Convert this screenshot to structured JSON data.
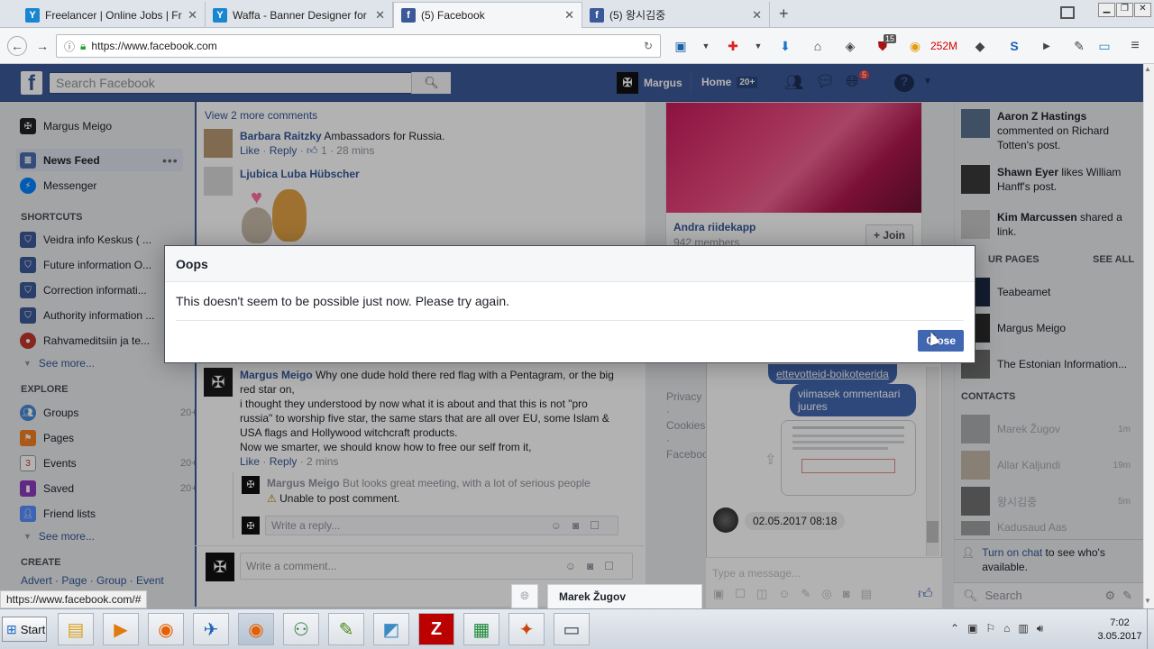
{
  "browser": {
    "tabs": [
      {
        "title": "Freelancer | Online Jobs | Free",
        "icon": "freelancer-icon",
        "color": "#1a86d0"
      },
      {
        "title": "Waffa - Banner Designer for",
        "icon": "freelancer-icon",
        "color": "#1a86d0"
      },
      {
        "title": "(5) Facebook",
        "icon": "facebook-icon",
        "color": "#3b5998"
      },
      {
        "title": "(5) 왕시김중",
        "icon": "facebook-icon",
        "color": "#3b5998"
      }
    ],
    "new_tab": "+",
    "url": "https://www.facebook.com",
    "ublock_badge": "15",
    "mega_count": "252M"
  },
  "fb": {
    "search_placeholder": "Search Facebook",
    "user_name": "Margus",
    "home_label": "Home",
    "home_badge": "20+",
    "notif_badge": "5"
  },
  "left": {
    "profile_name": "Margus Meigo",
    "news_feed": "News Feed",
    "messenger": "Messenger",
    "shortcuts_head": "SHORTCUTS",
    "shortcuts": [
      {
        "label": "Veidra info Keskus ( ..."
      },
      {
        "label": "Future information O..."
      },
      {
        "label": "Correction informati..."
      },
      {
        "label": "Authority information ..."
      },
      {
        "label": "Rahvameditsiin ja te..."
      }
    ],
    "see_more": "See more...",
    "explore_head": "EXPLORE",
    "explore": [
      {
        "label": "Groups",
        "count": "20+"
      },
      {
        "label": "Pages",
        "count": ""
      },
      {
        "label": "Events",
        "count": "20+"
      },
      {
        "label": "Saved",
        "count": "20+"
      },
      {
        "label": "Friend lists",
        "count": ""
      }
    ],
    "see_more2": "See more...",
    "create_head": "CREATE",
    "create_links": "Advert · Page · Group · Event"
  },
  "feed": {
    "view_more": "View 2 more comments",
    "c1_name": "Barbara Raitzky",
    "c1_text": "Ambassadors for Russia.",
    "like": "Like",
    "reply": "Reply",
    "c1_likes": "1",
    "c1_time": "28 mins",
    "c2_name": "Ljubica Luba Hübscher",
    "c3_name": "Margus Meigo",
    "c3_text1": "Why one dude hold there red flag with a Pentagram, or the big red star on,",
    "c3_text2": "i thought they understood by now what it is about and that this is not \"pro russia\" to worship five star, the same stars that are all over EU, some Islam & USA flags and Hollywood witchcraft products.",
    "c3_text3": "Now we smarter, we should know how to free our self from it,",
    "c3_time": "2 mins",
    "r1_name": "Margus Meigo",
    "r1_text": "But looks great meeting, with a lot of serious people",
    "r1_error": "Unable to post comment.",
    "reply_placeholder": "Write a reply...",
    "comment_placeholder": "Write a comment..."
  },
  "mid": {
    "group_name": "Andra riidekapp",
    "group_members": "942 members",
    "join": "+ Join",
    "footer": "Privacy · Cookies · Facebook"
  },
  "right": {
    "ticker": [
      {
        "name": "Aaron Z Hastings",
        "text": " commented on Richard Totten's post."
      },
      {
        "name": "Shawn Eyer",
        "text": " likes William Hanff's post."
      },
      {
        "name": "Kim Marcussen",
        "text": " shared a link."
      }
    ],
    "pages_head": "UR PAGES",
    "see_all": "SEE ALL",
    "pages": [
      "Teabeamet",
      "Margus Meigo",
      "The Estonian Information..."
    ],
    "contacts_head": "CONTACTS",
    "contacts": [
      {
        "name": "Marek Žugov",
        "time": "1m"
      },
      {
        "name": "Allar Kaljundi",
        "time": "19m"
      },
      {
        "name": "왕시김중",
        "time": "5m"
      },
      {
        "name": "Kadusaud Aas",
        "time": "..."
      }
    ],
    "turn_on_chat": "Turn on chat",
    "turn_on_chat_rest": " to see who's available.",
    "search": "Search"
  },
  "chat": {
    "msg1": "ettevotteid-boikoteerida",
    "msg2": "viimasek ommentaari juures",
    "timestamp": "02.05.2017 08:18",
    "placeholder": "Type a message...",
    "tab_name": "Marek Žugov"
  },
  "modal": {
    "title": "Oops",
    "body": "This doesn't seem to be possible just now. Please try again.",
    "close": "Close"
  },
  "status_url": "https://www.facebook.com/#",
  "taskbar": {
    "start": "Start",
    "time": "7:02",
    "date": "3.05.2017"
  }
}
